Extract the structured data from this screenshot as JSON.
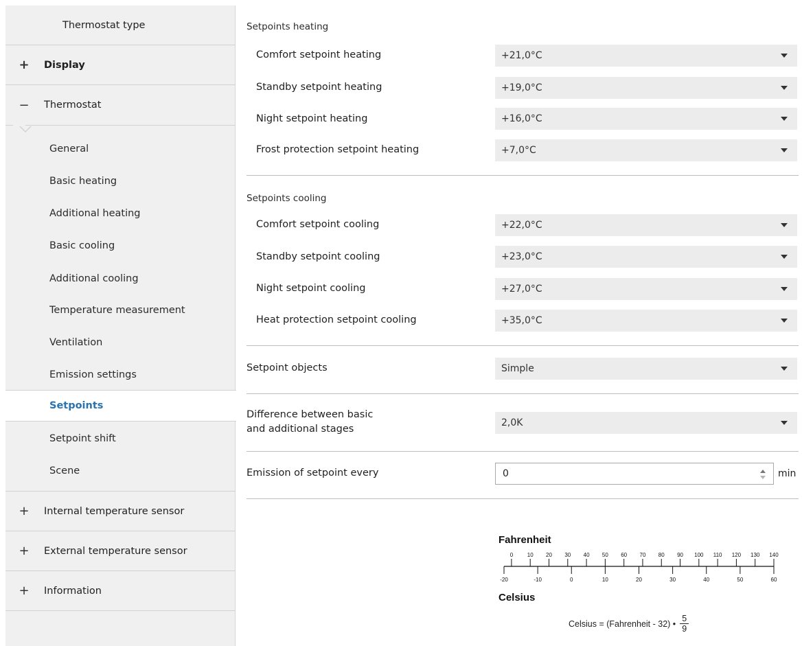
{
  "sidebar": {
    "thermostat_type": "Thermostat type",
    "display": {
      "sign": "+",
      "label": "Display"
    },
    "thermostat": {
      "sign": "−",
      "label": "Thermostat"
    },
    "items": [
      "General",
      "Basic heating",
      "Additional heating",
      "Basic cooling",
      "Additional cooling",
      "Temperature measurement",
      "Ventilation",
      "Emission settings",
      "Setpoints",
      "Setpoint shift",
      "Scene"
    ],
    "active_item": "Setpoints",
    "internal_sensor": {
      "sign": "+",
      "label": "Internal temperature sensor"
    },
    "external_sensor": {
      "sign": "+",
      "label": "External temperature sensor"
    },
    "information": {
      "sign": "+",
      "label": "Information"
    }
  },
  "main": {
    "heating": {
      "title": "Setpoints heating",
      "rows": [
        {
          "label": "Comfort setpoint heating",
          "value": "+21,0°C"
        },
        {
          "label": "Standby setpoint heating",
          "value": "+19,0°C"
        },
        {
          "label": "Night setpoint heating",
          "value": "+16,0°C"
        },
        {
          "label": "Frost protection setpoint heating",
          "value": "+7,0°C"
        }
      ]
    },
    "cooling": {
      "title": "Setpoints cooling",
      "rows": [
        {
          "label": "Comfort setpoint cooling",
          "value": "+22,0°C"
        },
        {
          "label": "Standby setpoint cooling",
          "value": "+23,0°C"
        },
        {
          "label": "Night setpoint cooling",
          "value": "+27,0°C"
        },
        {
          "label": "Heat protection setpoint cooling",
          "value": "+35,0°C"
        }
      ]
    },
    "setpoint_objects": {
      "label": "Setpoint objects",
      "value": "Simple"
    },
    "difference": {
      "label_line1": "Difference between basic",
      "label_line2": "and additional stages",
      "value": "2,0K"
    },
    "emission": {
      "label": "Emission of setpoint every",
      "value": "0",
      "unit": "min"
    }
  },
  "conversion": {
    "fahrenheit_label": "Fahrenheit",
    "celsius_label": "Celsius",
    "fahrenheit_ticks": [
      "0",
      "10",
      "20",
      "30",
      "40",
      "50",
      "60",
      "70",
      "80",
      "90",
      "100",
      "110",
      "120",
      "130",
      "140"
    ],
    "celsius_ticks": [
      "-20",
      "-10",
      "0",
      "10",
      "20",
      "30",
      "40",
      "50",
      "60"
    ],
    "formula_prefix": "Celsius = (Fahrenheit - 32) •",
    "formula_numerator": "5",
    "formula_denominator": "9"
  }
}
